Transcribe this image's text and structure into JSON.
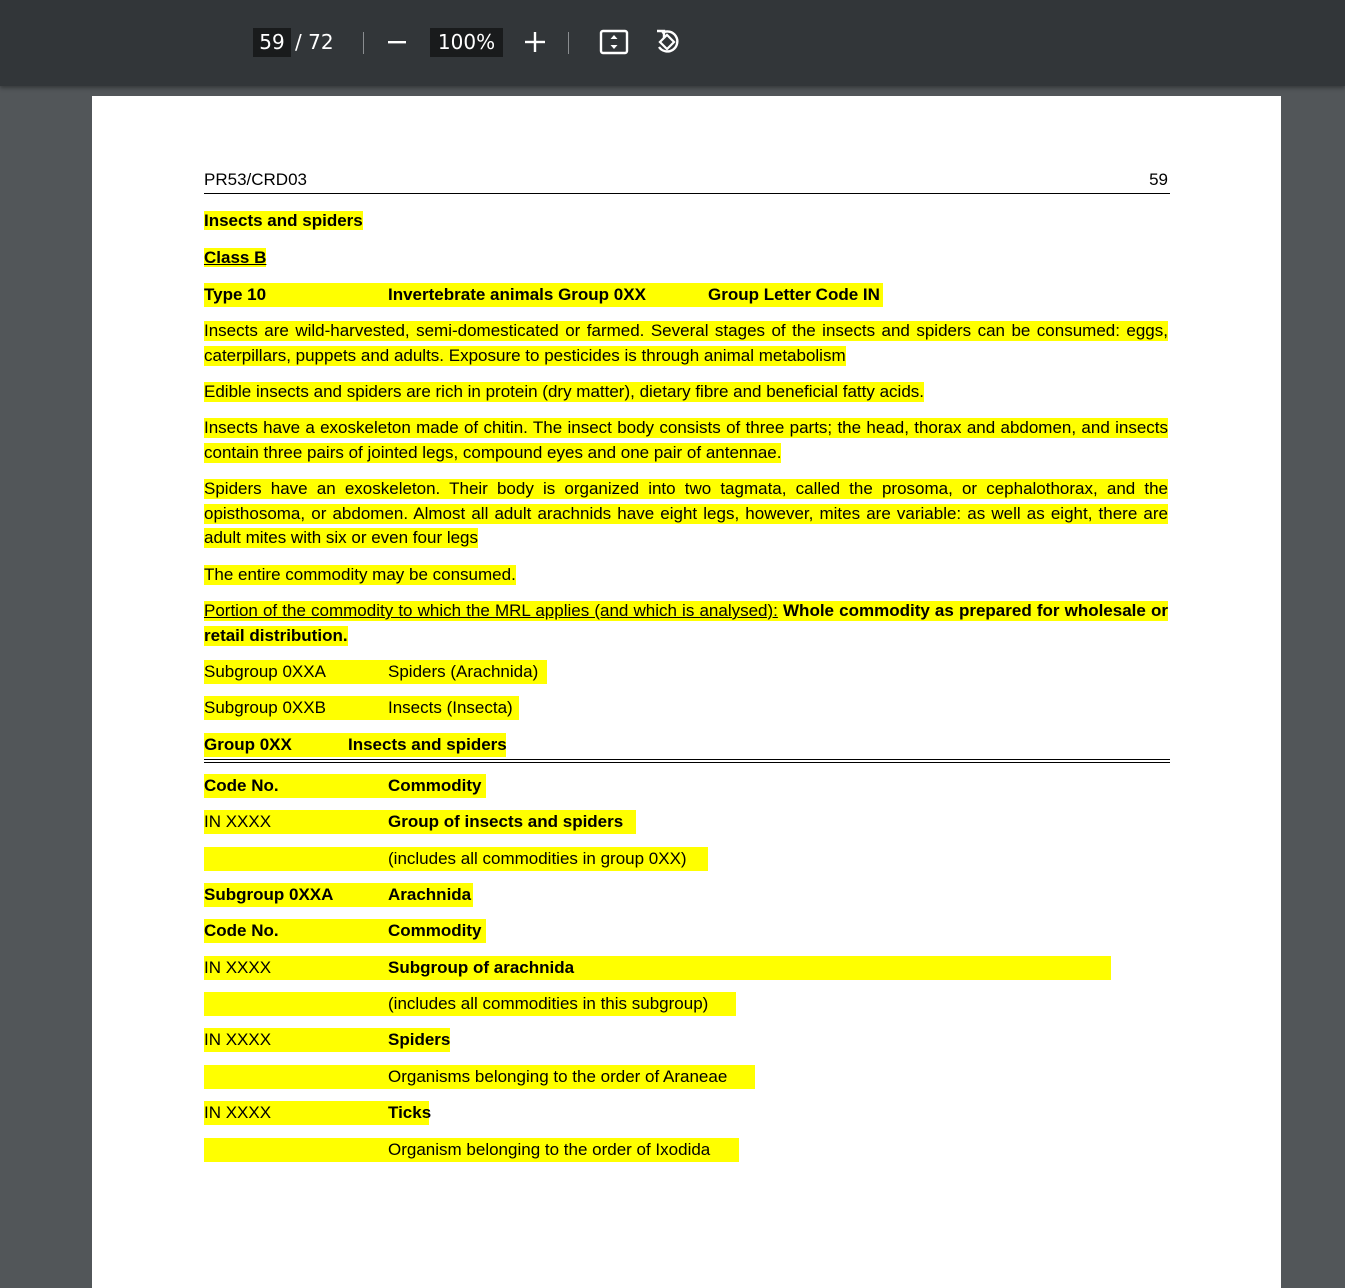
{
  "toolbar": {
    "current_page": "59",
    "total_pages": "/ 72",
    "zoom_level": "100%",
    "zoom_out_icon": "minus-icon",
    "zoom_in_icon": "plus-icon",
    "fit_icon": "fit-to-page-icon",
    "rotate_icon": "rotate-icon"
  },
  "page": {
    "header_left": "PR53/CRD03",
    "header_right": "59",
    "title": "Insects and spiders",
    "class": "Class B",
    "type_label": "Type 10",
    "type_group": "Invertebrate animals Group 0XX",
    "type_code": "Group Letter Code IN",
    "para1": "Insects are wild-harvested, semi-domesticated or farmed. Several stages of the insects and spiders can be consumed: eggs, caterpillars, puppets and adults. Exposure to pesticides is through animal metabolism",
    "para2": "Edible insects and spiders are rich in protein (dry matter), dietary fibre and beneficial fatty acids.",
    "para3": "Insects have a exoskeleton made of chitin. The insect body consists of three parts; the head, thorax and abdomen, and insects contain three pairs of jointed legs, compound eyes and one pair of antennae.",
    "para4": "Spiders have an exoskeleton. Their body is organized into two tagmata, called the prosoma, or cephalothorax, and the opisthosoma, or abdomen. Almost all adult arachnids have eight legs, however, mites are variable: as well as eight, there are adult mites with six or even four legs",
    "para5": "The entire commodity may be consumed.",
    "portion_label": "Portion of the commodity to which the MRL applies (and which is analysed):",
    "portion_value": "Whole commodity as prepared for wholesale or retail distribution.",
    "subgroups": [
      {
        "code": "Subgroup 0XXA",
        "name": "Spiders (Arachnida)"
      },
      {
        "code": "Subgroup 0XXB",
        "name": "Insects (Insecta)"
      }
    ],
    "group_code": "Group 0XX",
    "group_name": "Insects and spiders",
    "table1_head": {
      "code": "Code No.",
      "commodity": "Commodity"
    },
    "table1_rows": [
      {
        "code": "IN XXXX",
        "commodity": "Group of insects and spiders"
      },
      {
        "code": "",
        "commodity": "(includes all commodities in group 0XX)"
      }
    ],
    "subgroup_a_code": "Subgroup 0XXA",
    "subgroup_a_name": "Arachnida",
    "table2_head": {
      "code": "Code No.",
      "commodity": "Commodity"
    },
    "table2_rows": [
      {
        "code": "IN XXXX",
        "commodity": "Subgroup of arachnida"
      },
      {
        "code": "",
        "commodity": "(includes all commodities in this subgroup)"
      },
      {
        "code": "IN XXXX",
        "commodity": "Spiders"
      },
      {
        "code": "",
        "commodity": "Organisms belonging to the order of Araneae"
      },
      {
        "code": "IN XXXX",
        "commodity": "Ticks"
      },
      {
        "code": "",
        "commodity": "Organism belonging to the order of Ixodida"
      }
    ]
  }
}
